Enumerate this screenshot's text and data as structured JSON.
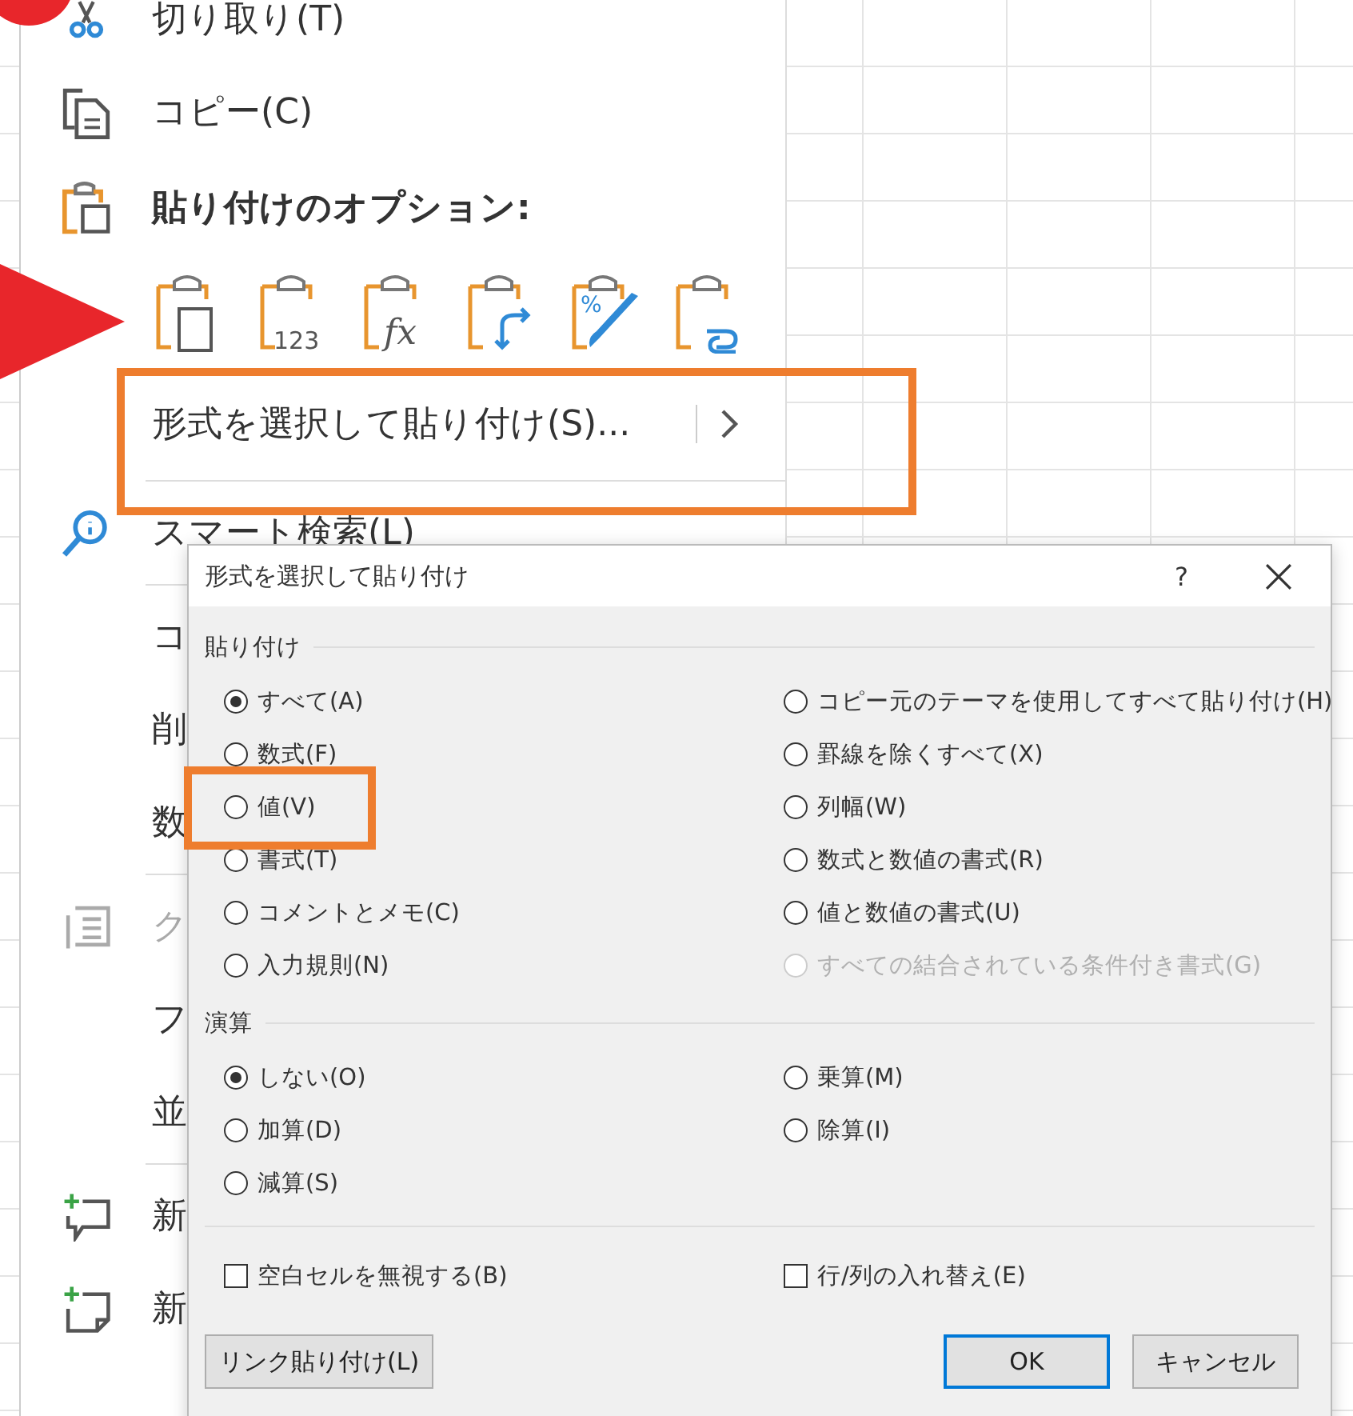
{
  "context_menu": {
    "items": [
      {
        "kind": "cut",
        "label": "切り取り(T)",
        "disabled": false
      },
      {
        "kind": "copy",
        "label": "コピー(C)",
        "disabled": false
      },
      {
        "kind": "header",
        "label": "貼り付けのオプション:",
        "disabled": false
      },
      {
        "kind": "paste_buttons",
        "buttons": [
          {
            "kind": "paste"
          },
          {
            "kind": "values",
            "glyph": "123"
          },
          {
            "kind": "formulas",
            "glyph": "fx"
          },
          {
            "kind": "transpose"
          },
          {
            "kind": "formatting",
            "glyph": "%"
          },
          {
            "kind": "link"
          }
        ]
      },
      {
        "kind": "submenu",
        "label": "形式を選択して貼り付け(S)...",
        "disabled": false
      },
      {
        "kind": "separator"
      },
      {
        "kind": "lookup",
        "label": "スマート検索(L)",
        "disabled": false
      },
      {
        "kind": "separator"
      },
      {
        "kind": "plain",
        "label": "コ",
        "disabled": false
      },
      {
        "kind": "plain",
        "label": "削",
        "disabled": false
      },
      {
        "kind": "plain",
        "label": "数",
        "disabled": false
      },
      {
        "kind": "separator"
      },
      {
        "kind": "quick",
        "label": "ク",
        "disabled": true
      },
      {
        "kind": "plain",
        "label": "フ",
        "disabled": false
      },
      {
        "kind": "plain",
        "label": "並",
        "disabled": false
      },
      {
        "kind": "separator"
      },
      {
        "kind": "new_comment",
        "label": "新",
        "disabled": false
      },
      {
        "kind": "new_note",
        "label": "新",
        "disabled": false
      }
    ]
  },
  "dialog": {
    "title": "形式を選択して貼り付け",
    "help": "?",
    "sections": [
      {
        "title": "貼り付け",
        "options": [
          {
            "label": "すべて(A)",
            "selected": true,
            "disabled": false
          },
          {
            "label": "コピー元のテーマを使用してすべて貼り付け(H)",
            "selected": false,
            "disabled": false
          },
          {
            "label": "数式(F)",
            "selected": false,
            "disabled": false
          },
          {
            "label": "罫線を除くすべて(X)",
            "selected": false,
            "disabled": false
          },
          {
            "label": "値(V)",
            "selected": false,
            "disabled": false
          },
          {
            "label": "列幅(W)",
            "selected": false,
            "disabled": false
          },
          {
            "label": "書式(T)",
            "selected": false,
            "disabled": false
          },
          {
            "label": "数式と数値の書式(R)",
            "selected": false,
            "disabled": false
          },
          {
            "label": "コメントとメモ(C)",
            "selected": false,
            "disabled": false
          },
          {
            "label": "値と数値の書式(U)",
            "selected": false,
            "disabled": false
          },
          {
            "label": "入力規則(N)",
            "selected": false,
            "disabled": false
          },
          {
            "label": "すべての結合されている条件付き書式(G)",
            "selected": false,
            "disabled": true
          }
        ]
      },
      {
        "title": "演算",
        "options": [
          {
            "label": "しない(O)",
            "selected": true,
            "disabled": false
          },
          {
            "label": "乗算(M)",
            "selected": false,
            "disabled": false
          },
          {
            "label": "加算(D)",
            "selected": false,
            "disabled": false
          },
          {
            "label": "除算(I)",
            "selected": false,
            "disabled": false
          },
          {
            "label": "減算(S)",
            "selected": false,
            "disabled": false
          }
        ]
      }
    ],
    "checkboxes": [
      {
        "label": "空白セルを無視する(B)",
        "checked": false
      },
      {
        "label": "行/列の入れ替え(E)",
        "checked": false
      }
    ],
    "buttons": [
      {
        "label": "リンク貼り付け(L)",
        "default": false
      },
      {
        "label": "OK",
        "default": true
      },
      {
        "label": "キャンセル",
        "default": false
      }
    ]
  }
}
